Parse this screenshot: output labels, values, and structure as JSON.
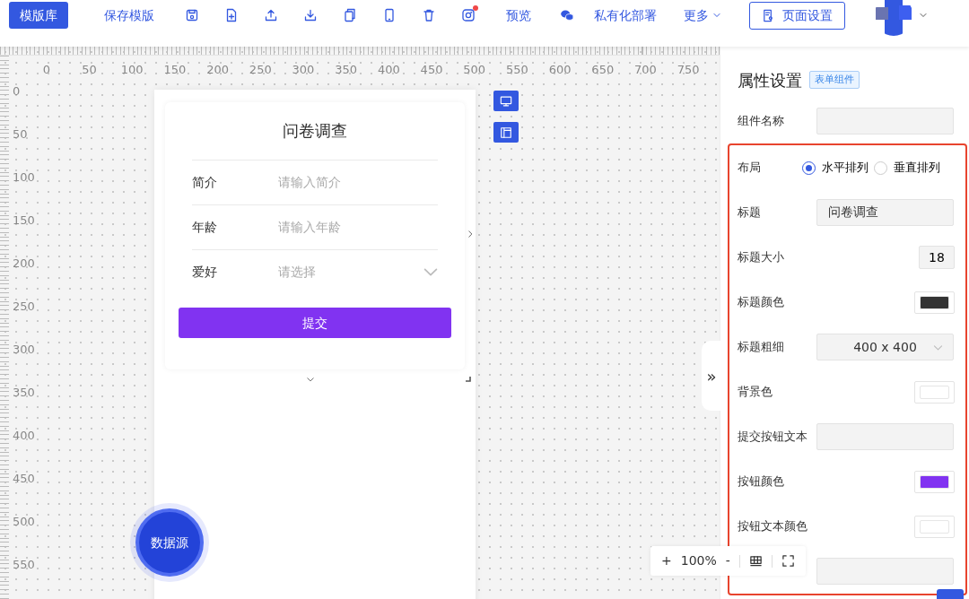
{
  "toolbar": {
    "primary_button": "模版库",
    "items": [
      {
        "kind": "text",
        "label": "保存模版"
      },
      {
        "kind": "icon",
        "notified": false
      },
      {
        "kind": "icon",
        "notified": false
      },
      {
        "kind": "icon",
        "notified": false
      },
      {
        "kind": "icon",
        "notified": false
      },
      {
        "kind": "icon",
        "notified": false
      },
      {
        "kind": "icon",
        "notified": false
      },
      {
        "kind": "icon",
        "notified": false
      },
      {
        "kind": "icon",
        "notified": true
      },
      {
        "kind": "text",
        "label": "预览"
      },
      {
        "kind": "icon",
        "notified": false
      },
      {
        "kind": "text",
        "label": "私有化部署"
      },
      {
        "kind": "dropdown",
        "label": "更多"
      }
    ],
    "page_settings_button": "页面设置"
  },
  "ruler": {
    "x_labels": [
      "0",
      "50",
      "100",
      "150",
      "200",
      "250",
      "300",
      "350",
      "400",
      "450",
      "500",
      "550",
      "600",
      "650",
      "700",
      "750"
    ],
    "y_labels": [
      "0",
      "50",
      "100",
      "150",
      "200",
      "250",
      "300",
      "350",
      "400",
      "450",
      "500",
      "550"
    ]
  },
  "form_preview": {
    "title": "问卷调查",
    "rows": [
      {
        "kind": "input",
        "label": "简介",
        "placeholder": "请输入简介"
      },
      {
        "kind": "input",
        "label": "年龄",
        "placeholder": "请输入年龄"
      },
      {
        "kind": "select",
        "label": "爱好",
        "placeholder": "请选择"
      }
    ],
    "submit_button": "提交"
  },
  "data_source_button": "数据源",
  "zoom_bar": {
    "zoom_in": "+",
    "zoom": "100%",
    "zoom_out": "-"
  },
  "collapse_tab": "»",
  "properties_panel": {
    "title": "属性设置",
    "tag": "表单组件",
    "sections": [
      {
        "highlighted": false,
        "fields": [
          {
            "kind": "text",
            "label": "组件名称"
          }
        ]
      },
      {
        "highlighted": true,
        "fields": [
          {
            "kind": "radio",
            "label": "布局",
            "options": [
              {
                "label": "水平排列",
                "selected": true
              },
              {
                "label": "垂直排列",
                "selected": false
              }
            ]
          },
          {
            "kind": "text",
            "label": "标题",
            "value": "问卷调查"
          },
          {
            "kind": "number",
            "label": "标题大小",
            "value": "18"
          },
          {
            "kind": "color",
            "label": "标题颜色",
            "color": "#333333"
          },
          {
            "kind": "select",
            "label": "标题粗细",
            "value": "400 x 400"
          },
          {
            "kind": "color",
            "label": "背景色",
            "color": "#ffffff"
          },
          {
            "kind": "text",
            "label": "提交按钮文本"
          },
          {
            "kind": "color",
            "label": "按钮颜色",
            "color": "#8133f1"
          },
          {
            "kind": "color",
            "label": "按钮文本颜色",
            "color": "#ffffff"
          },
          {
            "kind": "text"
          }
        ]
      }
    ]
  }
}
